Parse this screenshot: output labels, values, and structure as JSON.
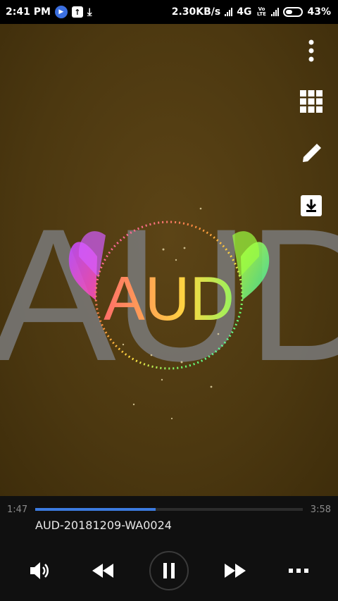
{
  "status_bar": {
    "time": "2:41 PM",
    "net_speed": "2.30KB/s",
    "network": "4G",
    "network_sub": "Vo LTE",
    "battery": "43%"
  },
  "visual": {
    "background_text": "AUD",
    "center_text": "AUD",
    "accent_colors": [
      "#ff4fd8",
      "#ffd640",
      "#6aff6a",
      "#41e0ff"
    ]
  },
  "side_actions": [
    "more-vert-icon",
    "grid-icon",
    "pencil-icon",
    "download-icon"
  ],
  "player": {
    "elapsed": "1:47",
    "total": "3:58",
    "progress": 0.45,
    "title": "AUD-20181209-WA0024",
    "controls": [
      "volume-icon",
      "rewind-icon",
      "pause-icon",
      "fast-forward-icon",
      "more-horiz-icon"
    ],
    "accent": "#3c7be0"
  }
}
